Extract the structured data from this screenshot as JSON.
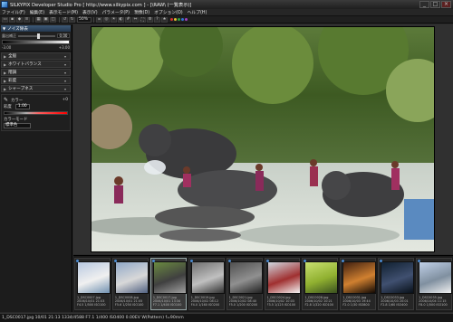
{
  "window": {
    "title": "SILKYPIX Developer Studio Pro [ http://www.silkypix.com ] - [\\RAW\\ (一覧表示)]",
    "controls": [
      "_",
      "□",
      "×"
    ]
  },
  "menu": [
    "ファイル(F)",
    "編集(E)",
    "表示モード(M)",
    "表示(V)",
    "パラメータ(P)",
    "現像(D)",
    "オプション(O)",
    "ヘルプ(H)"
  ],
  "toolbar": {
    "zoom": "50%",
    "icons": [
      "open-folder-icon",
      "save-icon",
      "develop-icon",
      "batch-icon",
      "thumbnail-view-icon",
      "preview-view-icon",
      "combined-view-icon",
      "rotate-left-icon",
      "rotate-right-icon",
      "crop-icon",
      "spot-icon",
      "highlight-warning-icon",
      "shadow-warning-icon",
      "grid-icon",
      "compare-icon",
      "fullscreen-icon",
      "settings-icon",
      "help-icon",
      "star-icon"
    ],
    "label_dots": [
      "#d03030",
      "#e0c030",
      "#30a040",
      "#3070d0",
      "#a040c0"
    ]
  },
  "left_panel": {
    "header": "ノイズ除去",
    "exposure": {
      "label": "露出補正",
      "value": "0.00",
      "scale_min": "-3.00",
      "scale_max": "+3.00"
    },
    "sections": [
      {
        "label": "全般"
      },
      {
        "label": "ホワイトバランス"
      },
      {
        "label": "階調"
      },
      {
        "label": "彩度"
      },
      {
        "label": "シャープネス"
      }
    ],
    "color": {
      "picker_label": "カラー",
      "mini_value": "+0",
      "field_label": "彩度",
      "field_value": "1.00",
      "mode_label": "カラーモード",
      "mode_value": "標準色"
    }
  },
  "preview": {
    "subject": "elephants-bathing-photo",
    "zoom_pct": 50
  },
  "filmstrip": [
    {
      "cap1": "1_DSC0007.jpg",
      "cap2": "2006/10/01 21:03",
      "cap3": "F4.5 1/500 ISO100",
      "palette": [
        "#b8c8e0",
        "#f0f0f0",
        "#7090b0"
      ]
    },
    {
      "cap1": "1_DSC0008.jpg",
      "cap2": "2006/10/01 21:05",
      "cap3": "F5.6 1/250 ISO100",
      "palette": [
        "#90a8c8",
        "#d8d8d8",
        "#506080"
      ]
    },
    {
      "cap1": "1_DSC0017.jpg",
      "cap2": "2006/10/01 13:34",
      "cap3": "F7.1 1/400 ISO100",
      "palette": [
        "#6a8a40",
        "#404040",
        "#a0a0a0"
      ],
      "selected": true
    },
    {
      "cap1": "1_DSC0019.jpg",
      "cap2": "2006/10/02 08:12",
      "cap3": "F4.0 1/160 ISO200",
      "palette": [
        "#707070",
        "#c0c0c0",
        "#303030"
      ]
    },
    {
      "cap1": "1_DSC0021.jpg",
      "cap2": "2006/10/02 08:40",
      "cap3": "F5.0 1/200 ISO200",
      "palette": [
        "#505050",
        "#909090",
        "#202020"
      ]
    },
    {
      "cap1": "1_DSC0024.jpg",
      "cap2": "2006/10/02 10:03",
      "cap3": "F3.5 1/125 ISO100",
      "palette": [
        "#d0d8e0",
        "#a03030",
        "#f4f4f4"
      ]
    },
    {
      "cap1": "1_DSC0028.jpg",
      "cap2": "2006/10/02 10:21",
      "cap3": "F2.8 1/320 ISO100",
      "palette": [
        "#c8e070",
        "#90b030",
        "#3a5020"
      ]
    },
    {
      "cap1": "1_DSC0031.jpg",
      "cap2": "2006/10/03 19:44",
      "cap3": "F2.0 1/30 ISO800",
      "palette": [
        "#402010",
        "#d08030",
        "#100804"
      ]
    },
    {
      "cap1": "1_DSC0033.jpg",
      "cap2": "2006/10/03 20:01",
      "cap3": "F2.8 1/60 ISO400",
      "palette": [
        "#102030",
        "#405070",
        "#081018"
      ]
    },
    {
      "cap1": "1_DSC0035.jpg",
      "cap2": "2006/10/04 11:15",
      "cap3": "F8.0 1/500 ISO100",
      "palette": [
        "#c0d0e8",
        "#8090a0",
        "#f0f0f0"
      ]
    }
  ],
  "status": "1_DSC0017.jpg  10/01 21:13 1334/4588  F7.1 1/400 ISO400  0.00EV W(Pattern) f=90mm"
}
